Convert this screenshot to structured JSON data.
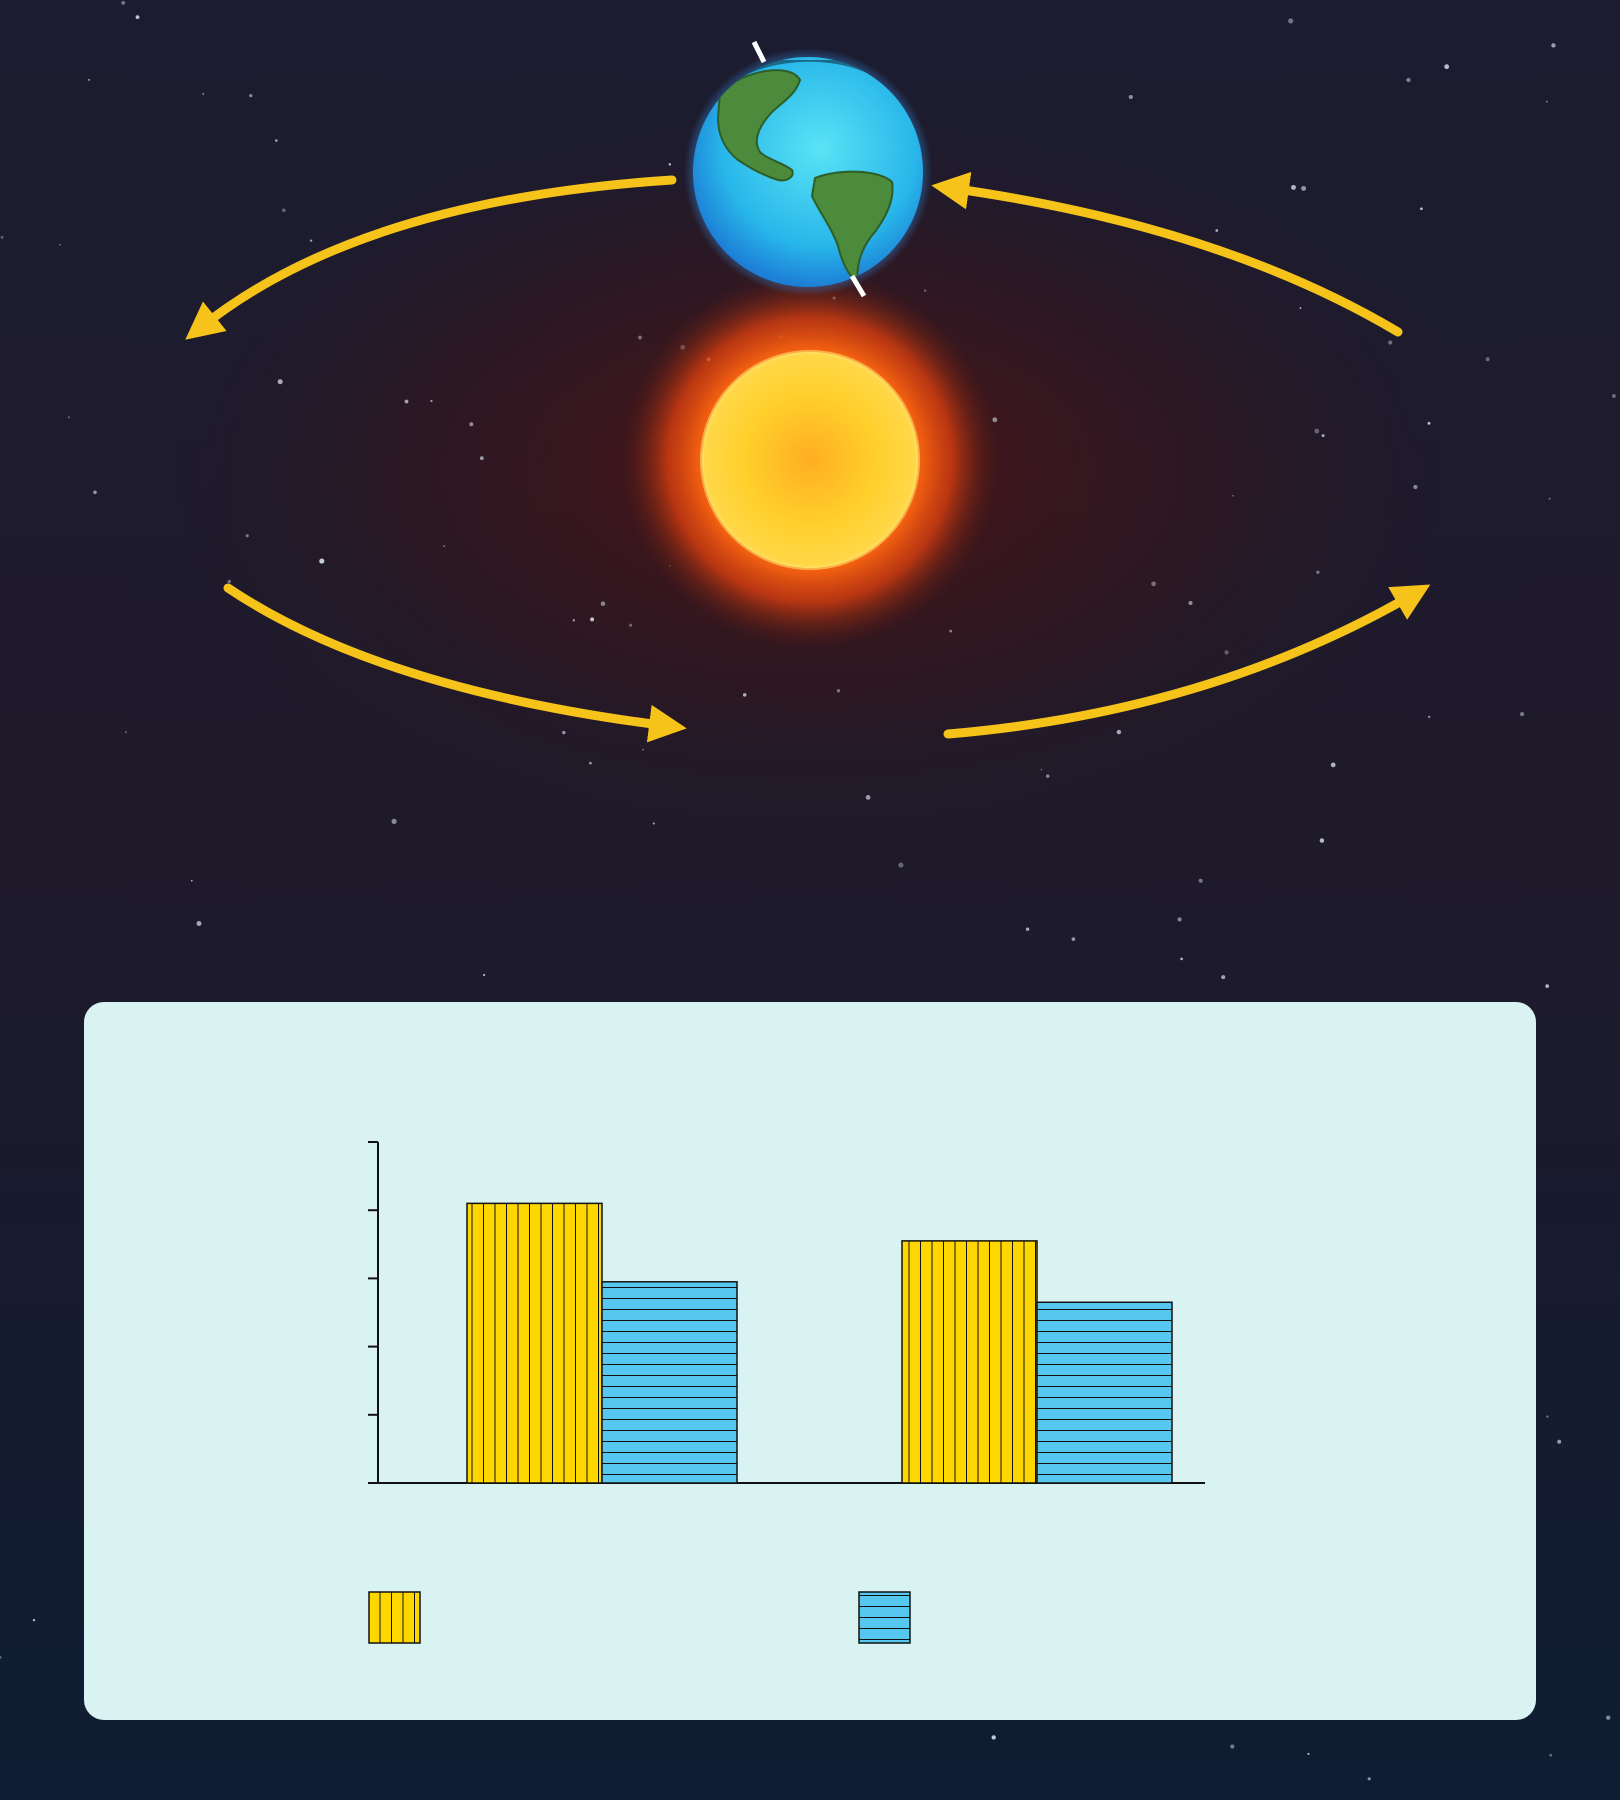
{
  "scene": {
    "background_top": "#1c1c30",
    "background_bottom": "#0e1d33",
    "sun_color": "#ffd21f",
    "sun_glow": "#ff5a1a",
    "earth_ocean": "#28b7ea",
    "earth_land": "#4c8a3c",
    "axis_color": "#ffffff",
    "orbit_arrow_color": "#f6c31a",
    "orbit_arrow_count": 4,
    "orbit_direction": "counterclockwise"
  },
  "chart_data": {
    "type": "bar",
    "title": "",
    "xlabel": "",
    "ylabel": "",
    "categories": [
      "",
      ""
    ],
    "series": [
      {
        "values": [
          4.1,
          3.55
        ],
        "color": "#ffd700",
        "hatch": "vertical"
      },
      {
        "values": [
          2.95,
          2.65
        ],
        "color": "#56c8ef",
        "hatch": "horizontal"
      }
    ],
    "ylim": [
      0,
      5
    ],
    "yticks": [
      0,
      1,
      2,
      3,
      4,
      5
    ],
    "tick_labels_shown": false,
    "grid": false,
    "legend": "bottom",
    "panel_color": "#d9f2f2"
  }
}
